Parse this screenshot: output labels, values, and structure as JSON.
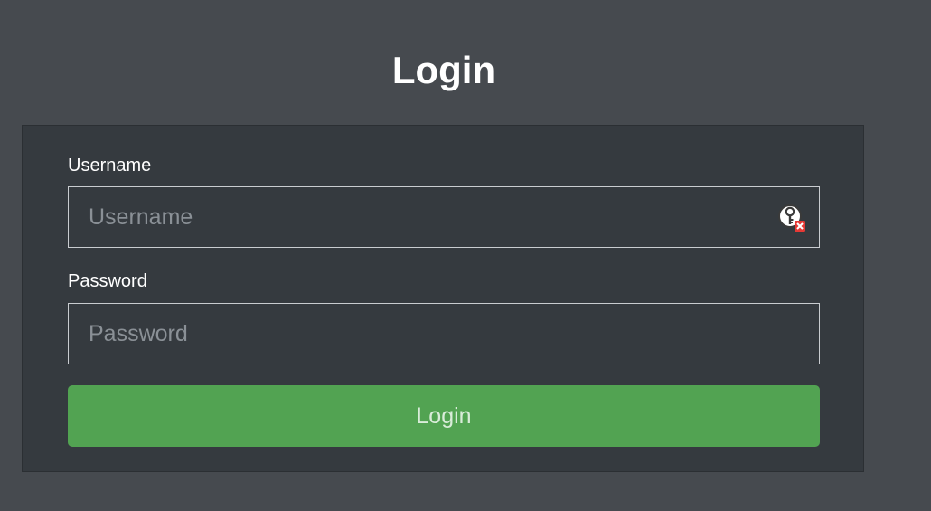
{
  "page": {
    "title": "Login"
  },
  "form": {
    "username": {
      "label": "Username",
      "placeholder": "Username",
      "value": "",
      "icon": "password-manager-key-icon"
    },
    "password": {
      "label": "Password",
      "placeholder": "Password",
      "value": ""
    },
    "submit_label": "Login"
  },
  "colors": {
    "background": "#464a4f",
    "panel": "#353a3f",
    "button": "#52a352",
    "icon_badge": "#e53935"
  }
}
